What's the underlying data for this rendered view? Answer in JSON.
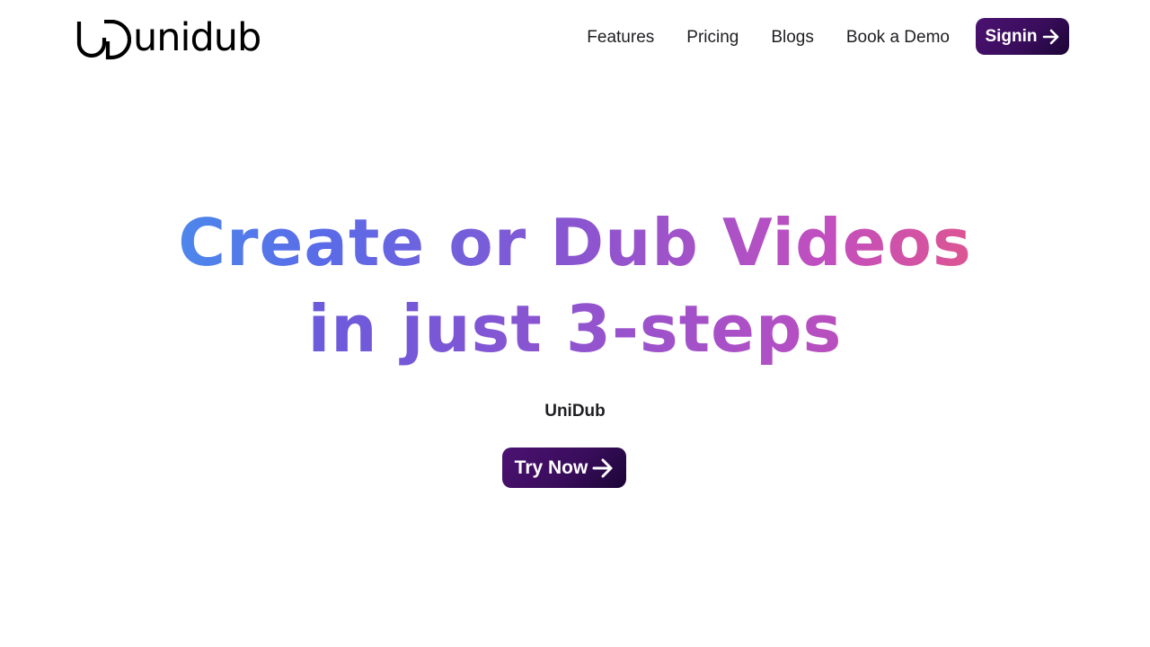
{
  "header": {
    "logo_text": "unidub",
    "nav": [
      {
        "label": "Features"
      },
      {
        "label": "Pricing"
      },
      {
        "label": "Blogs"
      },
      {
        "label": "Book a Demo"
      }
    ],
    "signin_label": "Signin"
  },
  "hero": {
    "title_line1": "Create or Dub Videos",
    "title_line2": "in just 3-steps",
    "subtitle": "UniDub",
    "cta_label": "Try Now"
  },
  "colors": {
    "button_gradient_start": "#4b1272",
    "button_gradient_end": "#1a0535",
    "title_gradient_start": "#3ea9f0",
    "title_gradient_mid": "#c24fbf",
    "title_gradient_end": "#fb7a57"
  },
  "icons": {
    "signin": "arrow-right-icon",
    "cta": "arrow-right-icon"
  }
}
